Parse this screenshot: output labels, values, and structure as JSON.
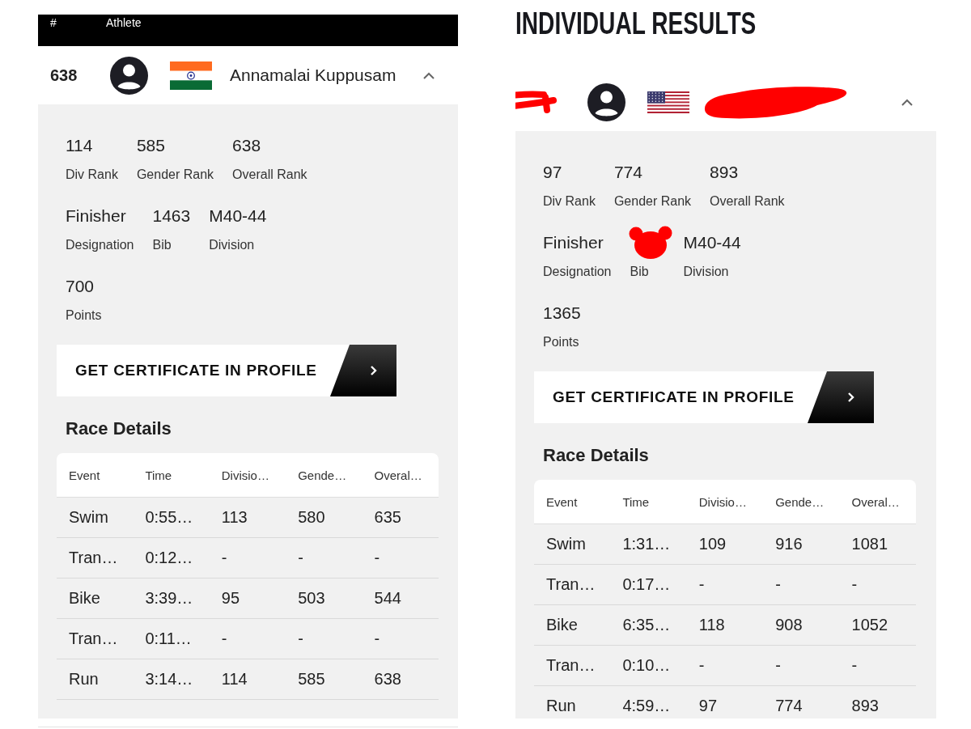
{
  "panels": [
    {
      "table_header": {
        "columns": [
          "#",
          "Athlete"
        ]
      },
      "athlete": {
        "rank": "638",
        "name": "Annamalai Kuppusam",
        "flag": {
          "kind": "india"
        },
        "expanded": true
      },
      "stat_rows": [
        {
          "items": [
            {
              "value": "114",
              "label": "Div Rank"
            },
            {
              "value": "585",
              "label": "Gender Rank"
            },
            {
              "value": "638",
              "label": "Overall Rank"
            }
          ]
        },
        {
          "items": [
            {
              "value": "Finisher",
              "label": "Designation"
            },
            {
              "value": "1463",
              "label": "Bib"
            },
            {
              "value": "M40-44",
              "label": "Division"
            }
          ]
        },
        {
          "items": [
            {
              "value": "700",
              "label": "Points"
            }
          ]
        }
      ],
      "certificate_button": "GET CERTIFICATE IN PROFILE",
      "race_details": {
        "title": "Race Details",
        "columns": [
          "Event",
          "Time",
          "Divisio…",
          "Gende…",
          "Overal…"
        ],
        "rows": [
          [
            "Swim",
            "0:55…",
            "113",
            "580",
            "635"
          ],
          [
            "Tran…",
            "0:12…",
            "-",
            "-",
            "-"
          ],
          [
            "Bike",
            "3:39…",
            "95",
            "503",
            "544"
          ],
          [
            "Tran…",
            "0:11…",
            "-",
            "-",
            "-"
          ],
          [
            "Run",
            "3:14…",
            "114",
            "585",
            "638"
          ]
        ]
      }
    },
    {
      "page_title": "INDIVIDUAL RESULTS",
      "athlete": {
        "rank_redacted": true,
        "name_redacted": true,
        "flag": {
          "kind": "usa"
        },
        "expanded": true
      },
      "stat_rows": [
        {
          "items": [
            {
              "value": "97",
              "label": "Div Rank"
            },
            {
              "value": "774",
              "label": "Gender Rank"
            },
            {
              "value": "893",
              "label": "Overall Rank"
            }
          ]
        },
        {
          "items": [
            {
              "value": "Finisher",
              "label": "Designation"
            },
            {
              "label": "Bib",
              "redacted": true
            },
            {
              "value": "M40-44",
              "label": "Division"
            }
          ]
        },
        {
          "items": [
            {
              "value": "1365",
              "label": "Points"
            }
          ]
        }
      ],
      "certificate_button": "GET CERTIFICATE IN PROFILE",
      "race_details": {
        "title": "Race Details",
        "columns": [
          "Event",
          "Time",
          "Divisio…",
          "Gende…",
          "Overal…"
        ],
        "rows": [
          [
            "Swim",
            "1:31…",
            "109",
            "916",
            "1081"
          ],
          [
            "Tran…",
            "0:17…",
            "-",
            "-",
            "-"
          ],
          [
            "Bike",
            "6:35…",
            "118",
            "908",
            "1052"
          ],
          [
            "Tran…",
            "0:10…",
            "-",
            "-",
            "-"
          ],
          [
            "Run",
            "4:59…",
            "97",
            "774",
            "893"
          ]
        ]
      }
    }
  ]
}
